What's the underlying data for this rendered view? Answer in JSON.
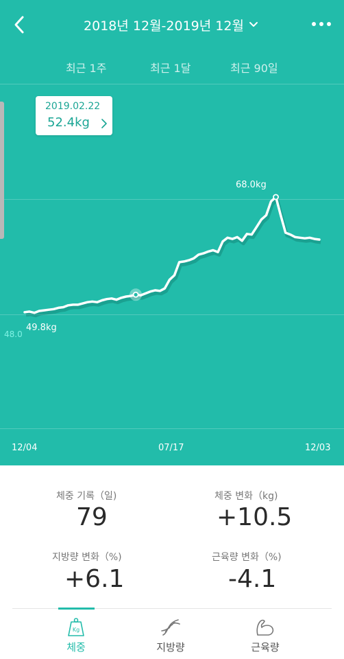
{
  "header": {
    "title": "2018년 12월-2019년 12월",
    "back_icon": "chevron-left-icon",
    "more_icon": "more-dots-icon"
  },
  "range_tabs": [
    {
      "label": "최근 1주"
    },
    {
      "label": "최근 1달"
    },
    {
      "label": "최근 90일"
    }
  ],
  "tooltip": {
    "date": "2019.02.22",
    "value": "52.4kg"
  },
  "chart_data": {
    "type": "line",
    "series": [
      {
        "values": [
          49.6,
          49.7,
          49.5,
          49.8,
          49.9,
          50.0,
          50.1,
          50.3,
          50.4,
          50.7,
          50.8,
          50.8,
          51.0,
          51.2,
          51.3,
          51.2,
          51.5,
          51.7,
          51.8,
          51.6,
          51.9,
          52.1,
          52.2,
          52.4,
          52.3,
          52.6,
          52.9,
          53.1,
          53.0,
          53.4,
          54.8,
          55.5,
          57.6,
          57.7,
          57.9,
          58.2,
          58.8,
          59.0,
          59.3,
          59.5,
          59.2,
          60.9,
          61.5,
          61.3,
          61.6,
          61.0,
          62.1,
          62.0,
          63.2,
          64.4,
          65.1,
          67.3,
          68.0,
          65.1,
          62.3,
          62.0,
          61.6,
          61.5,
          61.4,
          61.5,
          61.3,
          61.2
        ]
      }
    ],
    "annotations": [
      {
        "label": "68.0kg",
        "value": 68.0
      },
      {
        "label": "49.8kg",
        "value": 49.8
      },
      {
        "label": "48.0",
        "value": 48.0
      }
    ],
    "x_ticks": [
      "12/04",
      "07/17",
      "12/03"
    ],
    "y_min": 48.0,
    "line_color": "#ffffff",
    "background": "#22bcaa"
  },
  "stats": [
    {
      "label": "체중 기록（일)",
      "value": "79"
    },
    {
      "label": "체중 변화（kg)",
      "value": "+10.5"
    },
    {
      "label": "지방량 변화（%)",
      "value": "+6.1"
    },
    {
      "label": "근육량 변화（%)",
      "value": "-4.1"
    }
  ],
  "bottom_nav": [
    {
      "label": "체중",
      "icon": "scale-icon",
      "active": true
    },
    {
      "label": "지방량",
      "icon": "dna-icon",
      "active": false
    },
    {
      "label": "근육량",
      "icon": "muscle-arm-icon",
      "active": false
    }
  ],
  "colors": {
    "accent": "#22bcaa",
    "accent_text": "#1aa594"
  }
}
